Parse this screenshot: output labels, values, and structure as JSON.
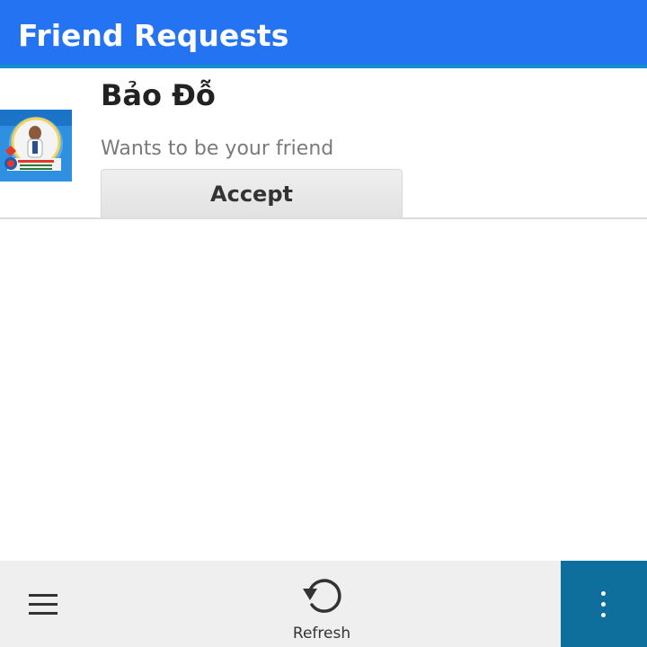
{
  "titlebar": {
    "title": "Friend Requests",
    "color": "#2473f2"
  },
  "request": {
    "name": "Bảo Đỗ",
    "message": "Wants to be your friend",
    "accept_label": "Accept"
  },
  "actionbar": {
    "menu_icon": "hamburger-menu-icon",
    "refresh_label": "Refresh",
    "refresh_icon": "refresh-icon",
    "overflow_icon": "more-vertical-icon",
    "overflow_color": "#0e6f9c"
  }
}
